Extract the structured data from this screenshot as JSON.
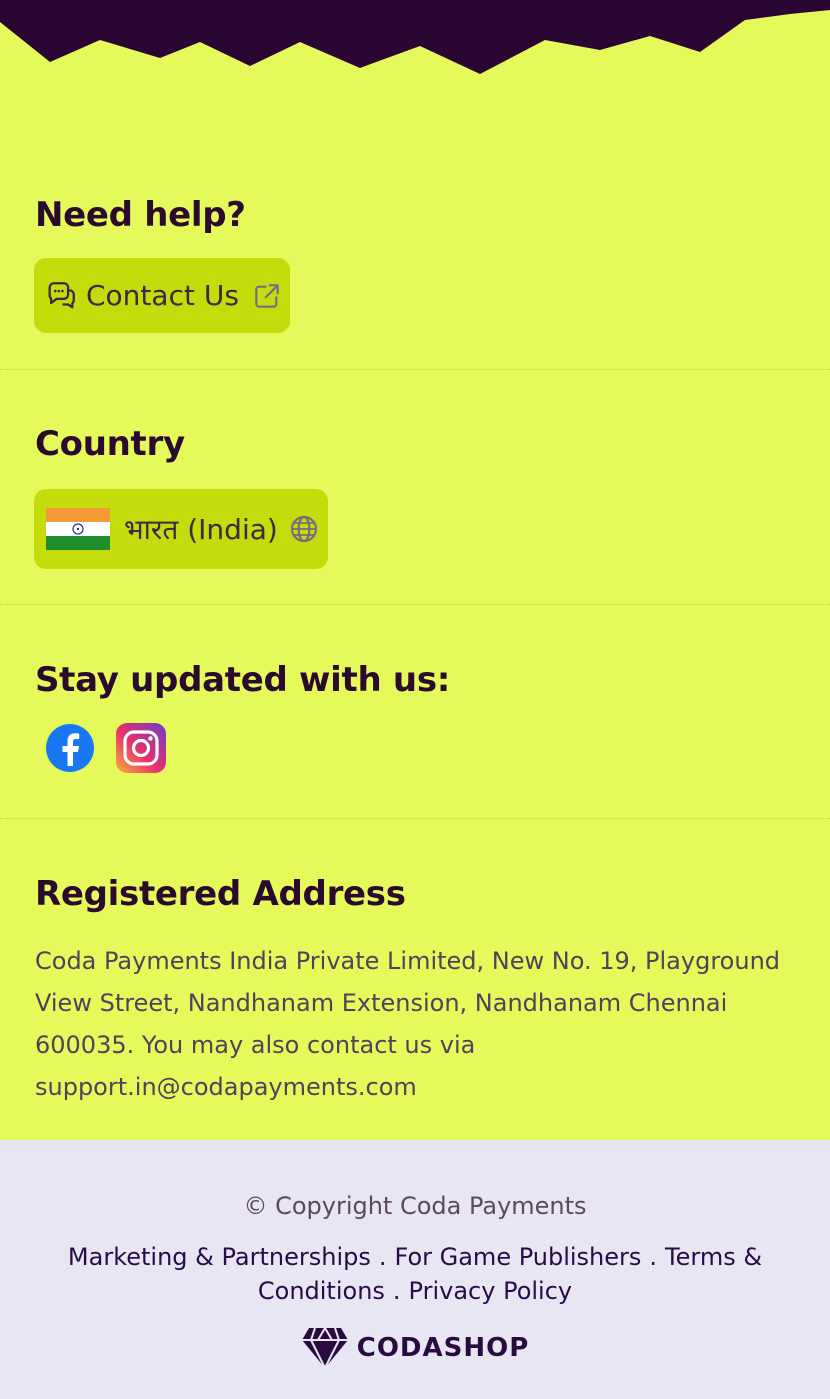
{
  "help": {
    "heading": "Need help?",
    "contact_label": "Contact Us"
  },
  "country": {
    "heading": "Country",
    "selected_label": "भारत (India)"
  },
  "social": {
    "heading": "Stay updated with us:",
    "icons": [
      "facebook-icon",
      "instagram-icon"
    ]
  },
  "address": {
    "heading": "Registered Address",
    "body": "Coda Payments India Private Limited, New No. 19, Playground View Street, Nandhanam Extension, Nandhanam Chennai 600035. You may also contact us via support.in@codapayments.com"
  },
  "footer": {
    "copyright": "© Copyright Coda Payments",
    "links": [
      "Marketing & Partnerships",
      "For Game Publishers",
      "Terms & Conditions",
      "Privacy Policy"
    ],
    "separator": ".",
    "brand": "CODASHOP"
  },
  "colors": {
    "page_band": "#e6f95b",
    "pill": "#c4dc0c",
    "dark": "#2a0b2e",
    "footer_bg": "#e8e6f3"
  }
}
